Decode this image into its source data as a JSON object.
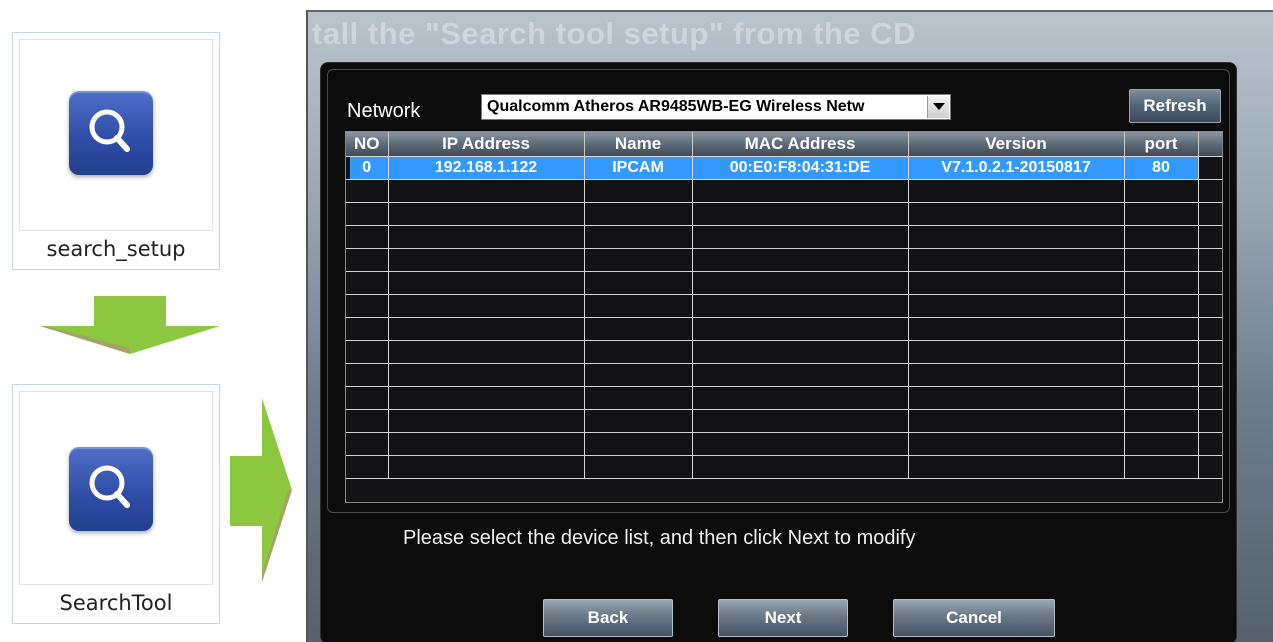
{
  "tiles": [
    {
      "label": "search_setup",
      "icon": "magnifier-app-icon"
    },
    {
      "label": "SearchTool",
      "icon": "magnifier-app-icon"
    }
  ],
  "colors": {
    "arrow_green": "#8dc63f",
    "selection_blue": "#3399ff",
    "icon_blue": "#2f4ea8"
  },
  "dialog": {
    "faded_caption": "tall the \"Search tool  setup\" from the CD",
    "network_label": "Network",
    "network_selected": "Qualcomm Atheros AR9485WB-EG Wireless Netw",
    "refresh_label": "Refresh",
    "table": {
      "columns": [
        "NO",
        "IP Address",
        "Name",
        "MAC Address",
        "Version",
        "port"
      ],
      "rows": [
        [
          "0",
          "192.168.1.122",
          "IPCAM",
          "00:E0:F8:04:31:DE",
          "V7.1.0.2.1-20150817",
          "80"
        ]
      ],
      "empty_rows": 13
    },
    "status_text": "Please select the device list, and then click Next to modify",
    "buttons": {
      "back": "Back",
      "next": "Next",
      "cancel": "Cancel"
    }
  }
}
